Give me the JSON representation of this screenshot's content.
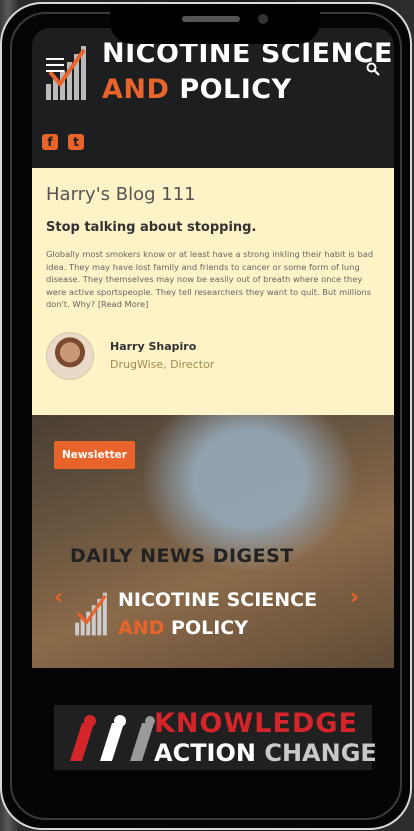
{
  "header": {
    "logo_line1": "NICOTINE SCIENCE",
    "logo_and": "AND",
    "logo_policy": "POLICY",
    "social": [
      {
        "icon": "facebook-icon",
        "glyph": "f"
      },
      {
        "icon": "twitter-icon",
        "glyph": "t"
      }
    ]
  },
  "blog": {
    "title": "Harry's Blog 111",
    "subtitle": "Stop talking about stopping.",
    "excerpt": "Globally most smokers know or at least have a strong inkling their habit is bad idea. They may have lost family and friends to cancer or some form of lung disease. They themselves may now be easily out of breath where once they were active sportspeople. They tell researchers they want to quit. But millions don't. Why? [Read More]",
    "author_name": "Harry Shapiro",
    "author_role": "DrugWise, Director"
  },
  "banner": {
    "newsletter_label": "Newsletter",
    "digest_title": "DAILY NEWS DIGEST",
    "arrow_left": "‹",
    "arrow_right": "›",
    "logo_line1": "NICOTINE SCIENCE",
    "logo_and": "AND",
    "logo_policy": "POLICY"
  },
  "kac": {
    "line1": "KNOWLEDGE",
    "action": "ACTION",
    "change": "CHANGE"
  },
  "colors": {
    "accent": "#e8642a",
    "header_bg": "#1d1e20",
    "card_bg": "#fdf3c7",
    "kac_red": "#d4252a"
  }
}
